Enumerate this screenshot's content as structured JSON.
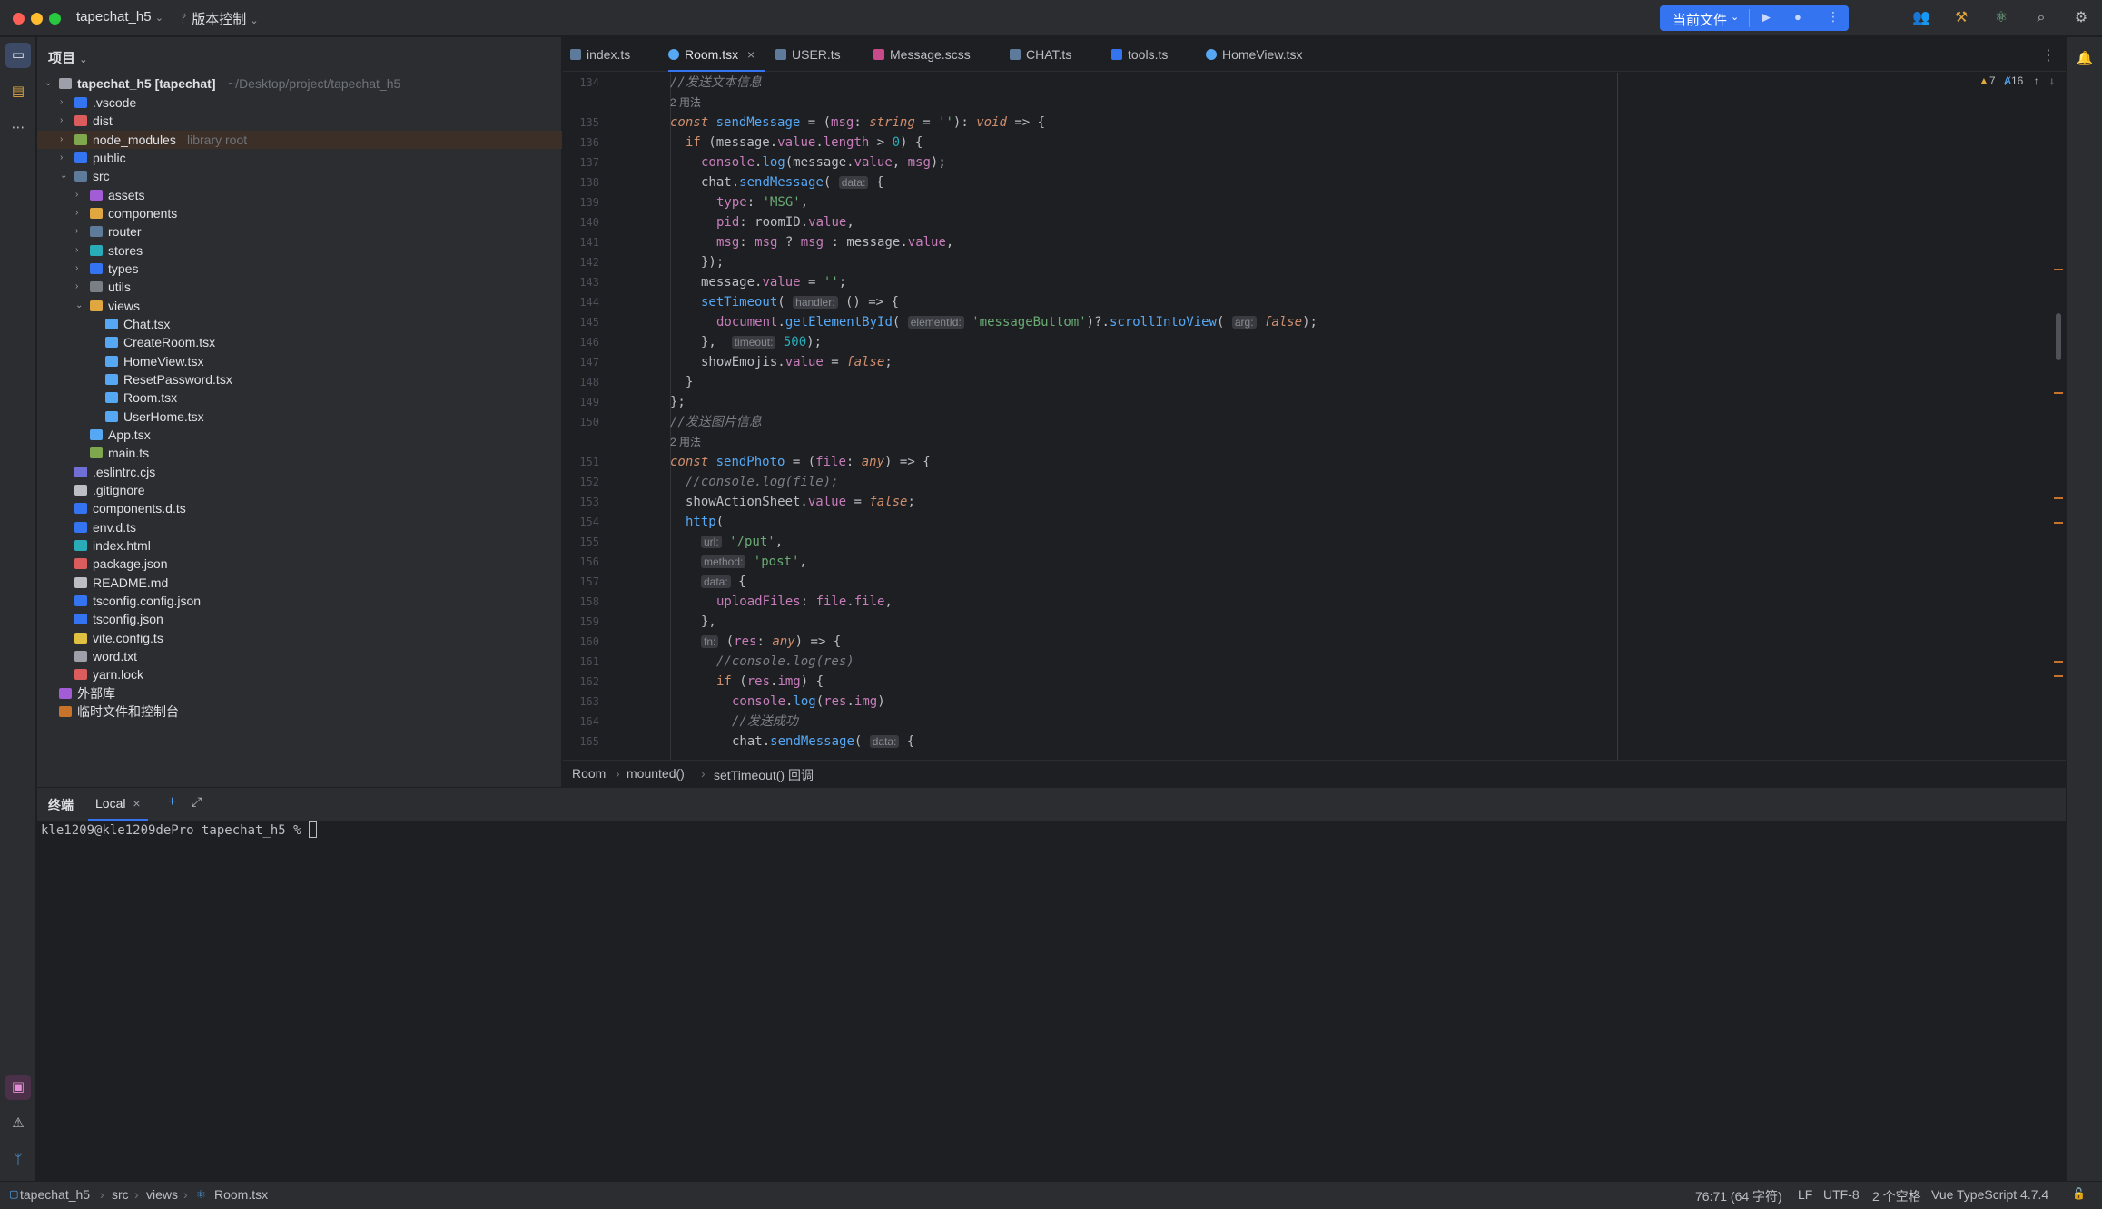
{
  "titlebar": {
    "project_name": "tapechat_h5",
    "vcs_label": "版本控制",
    "run_config_label": "当前文件"
  },
  "project_panel": {
    "title": "项目",
    "root_name": "tapechat_h5 [tapechat]",
    "root_path": "~/Desktop/project/tapechat_h5",
    "items": [
      {
        "name": ".vscode",
        "tag": ""
      },
      {
        "name": "dist",
        "tag": ""
      },
      {
        "name": "node_modules",
        "tag": "library root"
      },
      {
        "name": "public",
        "tag": ""
      },
      {
        "name": "src",
        "tag": ""
      },
      {
        "name": "assets",
        "tag": ""
      },
      {
        "name": "components",
        "tag": ""
      },
      {
        "name": "router",
        "tag": ""
      },
      {
        "name": "stores",
        "tag": ""
      },
      {
        "name": "types",
        "tag": ""
      },
      {
        "name": "utils",
        "tag": ""
      },
      {
        "name": "views",
        "tag": ""
      },
      {
        "name": "Chat.tsx",
        "tag": ""
      },
      {
        "name": "CreateRoom.tsx",
        "tag": ""
      },
      {
        "name": "HomeView.tsx",
        "tag": ""
      },
      {
        "name": "ResetPassword.tsx",
        "tag": ""
      },
      {
        "name": "Room.tsx",
        "tag": ""
      },
      {
        "name": "UserHome.tsx",
        "tag": ""
      },
      {
        "name": "App.tsx",
        "tag": ""
      },
      {
        "name": "main.ts",
        "tag": ""
      },
      {
        "name": ".eslintrc.cjs",
        "tag": ""
      },
      {
        "name": ".gitignore",
        "tag": ""
      },
      {
        "name": "components.d.ts",
        "tag": ""
      },
      {
        "name": "env.d.ts",
        "tag": ""
      },
      {
        "name": "index.html",
        "tag": ""
      },
      {
        "name": "package.json",
        "tag": ""
      },
      {
        "name": "README.md",
        "tag": ""
      },
      {
        "name": "tsconfig.config.json",
        "tag": ""
      },
      {
        "name": "tsconfig.json",
        "tag": ""
      },
      {
        "name": "vite.config.ts",
        "tag": ""
      },
      {
        "name": "word.txt",
        "tag": ""
      },
      {
        "name": "yarn.lock",
        "tag": ""
      },
      {
        "name": "外部库",
        "tag": ""
      },
      {
        "name": "临时文件和控制台",
        "tag": ""
      }
    ]
  },
  "tabs": [
    "index.ts",
    "Room.tsx",
    "USER.ts",
    "Message.scss",
    "CHAT.ts",
    "tools.ts",
    "HomeView.tsx"
  ],
  "editor": {
    "problems": "7",
    "warnings": "16",
    "line_numbers": [
      "134",
      "",
      "135",
      "136",
      "137",
      "138",
      "139",
      "140",
      "141",
      "142",
      "143",
      "144",
      "145",
      "146",
      "147",
      "148",
      "149",
      "150",
      "",
      "151",
      "152",
      "153",
      "154",
      "155",
      "156",
      "157",
      "158",
      "159",
      "160",
      "161",
      "162",
      "163",
      "164",
      "165"
    ],
    "usage_hint": "2 用法",
    "comment_send_text": "//发送文本信息",
    "comment_send_photo": "//发送图片信息",
    "comment_console_file": "//console.log(file);",
    "comment_console_res": "//console.log(res)",
    "comment_send_success": "//发送成功"
  },
  "breadcrumb": [
    "Room",
    "mounted()",
    "setTimeout() 回调"
  ],
  "terminal": {
    "title": "终端",
    "tab_label": "Local",
    "prompt": "kle1209@kle1209dePro tapechat_h5 % "
  },
  "statusbar": {
    "path": [
      "tapechat_h5",
      "src",
      "views",
      "Room.tsx"
    ],
    "position": "76:71 (64 字符)",
    "line_sep": "LF",
    "encoding": "UTF-8",
    "indent": "2 个空格",
    "language": "Vue TypeScript 4.7.4"
  }
}
